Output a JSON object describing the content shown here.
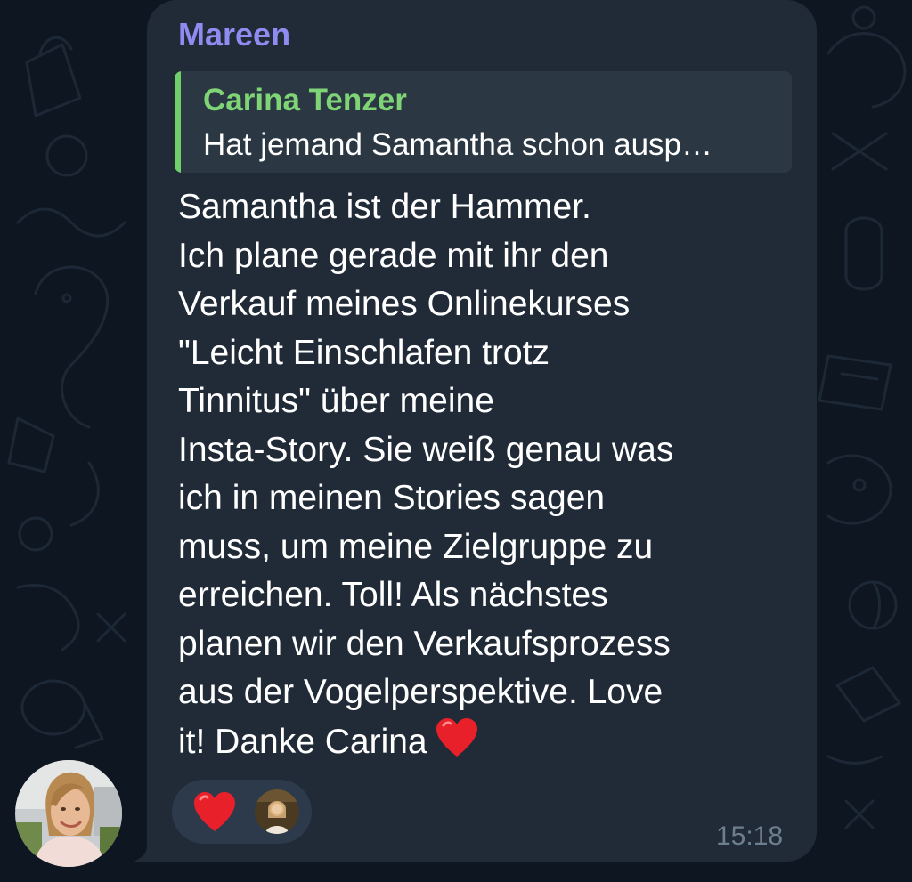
{
  "message": {
    "sender": "Mareen",
    "reply": {
      "author": "Carina Tenzer",
      "preview": "Hat jemand Samantha schon ausp…"
    },
    "lines": [
      "Samantha ist der Hammer.",
      "Ich plane gerade mit ihr den",
      "Verkauf meines Onlinekurses",
      "\"Leicht Einschlafen trotz",
      "Tinnitus\" über meine",
      "Insta-Story. Sie weiß genau was",
      "ich in meinen Stories sagen",
      "muss, um meine Zielgruppe zu",
      "erreichen. Toll! Als nächstes",
      "planen wir den Verkaufsprozess",
      "aus der Vogelperspektive. Love",
      "it! Danke Carina"
    ],
    "trailing_emoji": "red-heart",
    "time": "15:18",
    "reactions": [
      {
        "emoji": "red-heart",
        "reactor": "user-avatar"
      }
    ]
  },
  "colors": {
    "background": "#0e1621",
    "bubble": "#212b37",
    "sender_name": "#8e8cf0",
    "reply_accent": "#6fcf6a",
    "reply_name": "#7fd575",
    "reply_bg": "#2b3743",
    "text": "#ffffff",
    "timestamp": "#6d7f8f",
    "reaction_bg": "#2c3a4c",
    "heart": "#e8202a"
  }
}
